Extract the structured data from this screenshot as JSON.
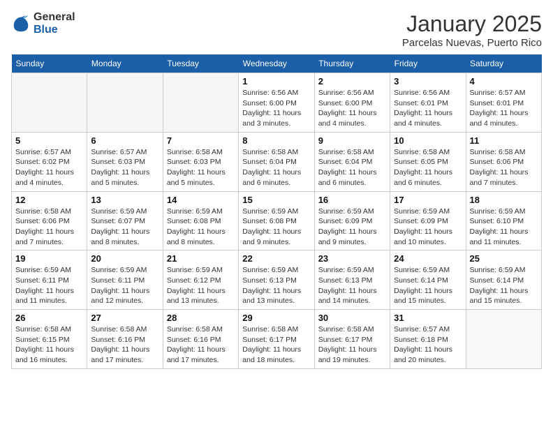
{
  "header": {
    "logo_general": "General",
    "logo_blue": "Blue",
    "calendar_title": "January 2025",
    "calendar_subtitle": "Parcelas Nuevas, Puerto Rico"
  },
  "weekdays": [
    "Sunday",
    "Monday",
    "Tuesday",
    "Wednesday",
    "Thursday",
    "Friday",
    "Saturday"
  ],
  "weeks": [
    [
      {
        "day": "",
        "info": ""
      },
      {
        "day": "",
        "info": ""
      },
      {
        "day": "",
        "info": ""
      },
      {
        "day": "1",
        "info": "Sunrise: 6:56 AM\nSunset: 6:00 PM\nDaylight: 11 hours and 3 minutes."
      },
      {
        "day": "2",
        "info": "Sunrise: 6:56 AM\nSunset: 6:00 PM\nDaylight: 11 hours and 4 minutes."
      },
      {
        "day": "3",
        "info": "Sunrise: 6:56 AM\nSunset: 6:01 PM\nDaylight: 11 hours and 4 minutes."
      },
      {
        "day": "4",
        "info": "Sunrise: 6:57 AM\nSunset: 6:01 PM\nDaylight: 11 hours and 4 minutes."
      }
    ],
    [
      {
        "day": "5",
        "info": "Sunrise: 6:57 AM\nSunset: 6:02 PM\nDaylight: 11 hours and 4 minutes."
      },
      {
        "day": "6",
        "info": "Sunrise: 6:57 AM\nSunset: 6:03 PM\nDaylight: 11 hours and 5 minutes."
      },
      {
        "day": "7",
        "info": "Sunrise: 6:58 AM\nSunset: 6:03 PM\nDaylight: 11 hours and 5 minutes."
      },
      {
        "day": "8",
        "info": "Sunrise: 6:58 AM\nSunset: 6:04 PM\nDaylight: 11 hours and 6 minutes."
      },
      {
        "day": "9",
        "info": "Sunrise: 6:58 AM\nSunset: 6:04 PM\nDaylight: 11 hours and 6 minutes."
      },
      {
        "day": "10",
        "info": "Sunrise: 6:58 AM\nSunset: 6:05 PM\nDaylight: 11 hours and 6 minutes."
      },
      {
        "day": "11",
        "info": "Sunrise: 6:58 AM\nSunset: 6:06 PM\nDaylight: 11 hours and 7 minutes."
      }
    ],
    [
      {
        "day": "12",
        "info": "Sunrise: 6:58 AM\nSunset: 6:06 PM\nDaylight: 11 hours and 7 minutes."
      },
      {
        "day": "13",
        "info": "Sunrise: 6:59 AM\nSunset: 6:07 PM\nDaylight: 11 hours and 8 minutes."
      },
      {
        "day": "14",
        "info": "Sunrise: 6:59 AM\nSunset: 6:08 PM\nDaylight: 11 hours and 8 minutes."
      },
      {
        "day": "15",
        "info": "Sunrise: 6:59 AM\nSunset: 6:08 PM\nDaylight: 11 hours and 9 minutes."
      },
      {
        "day": "16",
        "info": "Sunrise: 6:59 AM\nSunset: 6:09 PM\nDaylight: 11 hours and 9 minutes."
      },
      {
        "day": "17",
        "info": "Sunrise: 6:59 AM\nSunset: 6:09 PM\nDaylight: 11 hours and 10 minutes."
      },
      {
        "day": "18",
        "info": "Sunrise: 6:59 AM\nSunset: 6:10 PM\nDaylight: 11 hours and 11 minutes."
      }
    ],
    [
      {
        "day": "19",
        "info": "Sunrise: 6:59 AM\nSunset: 6:11 PM\nDaylight: 11 hours and 11 minutes."
      },
      {
        "day": "20",
        "info": "Sunrise: 6:59 AM\nSunset: 6:11 PM\nDaylight: 11 hours and 12 minutes."
      },
      {
        "day": "21",
        "info": "Sunrise: 6:59 AM\nSunset: 6:12 PM\nDaylight: 11 hours and 13 minutes."
      },
      {
        "day": "22",
        "info": "Sunrise: 6:59 AM\nSunset: 6:13 PM\nDaylight: 11 hours and 13 minutes."
      },
      {
        "day": "23",
        "info": "Sunrise: 6:59 AM\nSunset: 6:13 PM\nDaylight: 11 hours and 14 minutes."
      },
      {
        "day": "24",
        "info": "Sunrise: 6:59 AM\nSunset: 6:14 PM\nDaylight: 11 hours and 15 minutes."
      },
      {
        "day": "25",
        "info": "Sunrise: 6:59 AM\nSunset: 6:14 PM\nDaylight: 11 hours and 15 minutes."
      }
    ],
    [
      {
        "day": "26",
        "info": "Sunrise: 6:58 AM\nSunset: 6:15 PM\nDaylight: 11 hours and 16 minutes."
      },
      {
        "day": "27",
        "info": "Sunrise: 6:58 AM\nSunset: 6:16 PM\nDaylight: 11 hours and 17 minutes."
      },
      {
        "day": "28",
        "info": "Sunrise: 6:58 AM\nSunset: 6:16 PM\nDaylight: 11 hours and 17 minutes."
      },
      {
        "day": "29",
        "info": "Sunrise: 6:58 AM\nSunset: 6:17 PM\nDaylight: 11 hours and 18 minutes."
      },
      {
        "day": "30",
        "info": "Sunrise: 6:58 AM\nSunset: 6:17 PM\nDaylight: 11 hours and 19 minutes."
      },
      {
        "day": "31",
        "info": "Sunrise: 6:57 AM\nSunset: 6:18 PM\nDaylight: 11 hours and 20 minutes."
      },
      {
        "day": "",
        "info": ""
      }
    ]
  ]
}
